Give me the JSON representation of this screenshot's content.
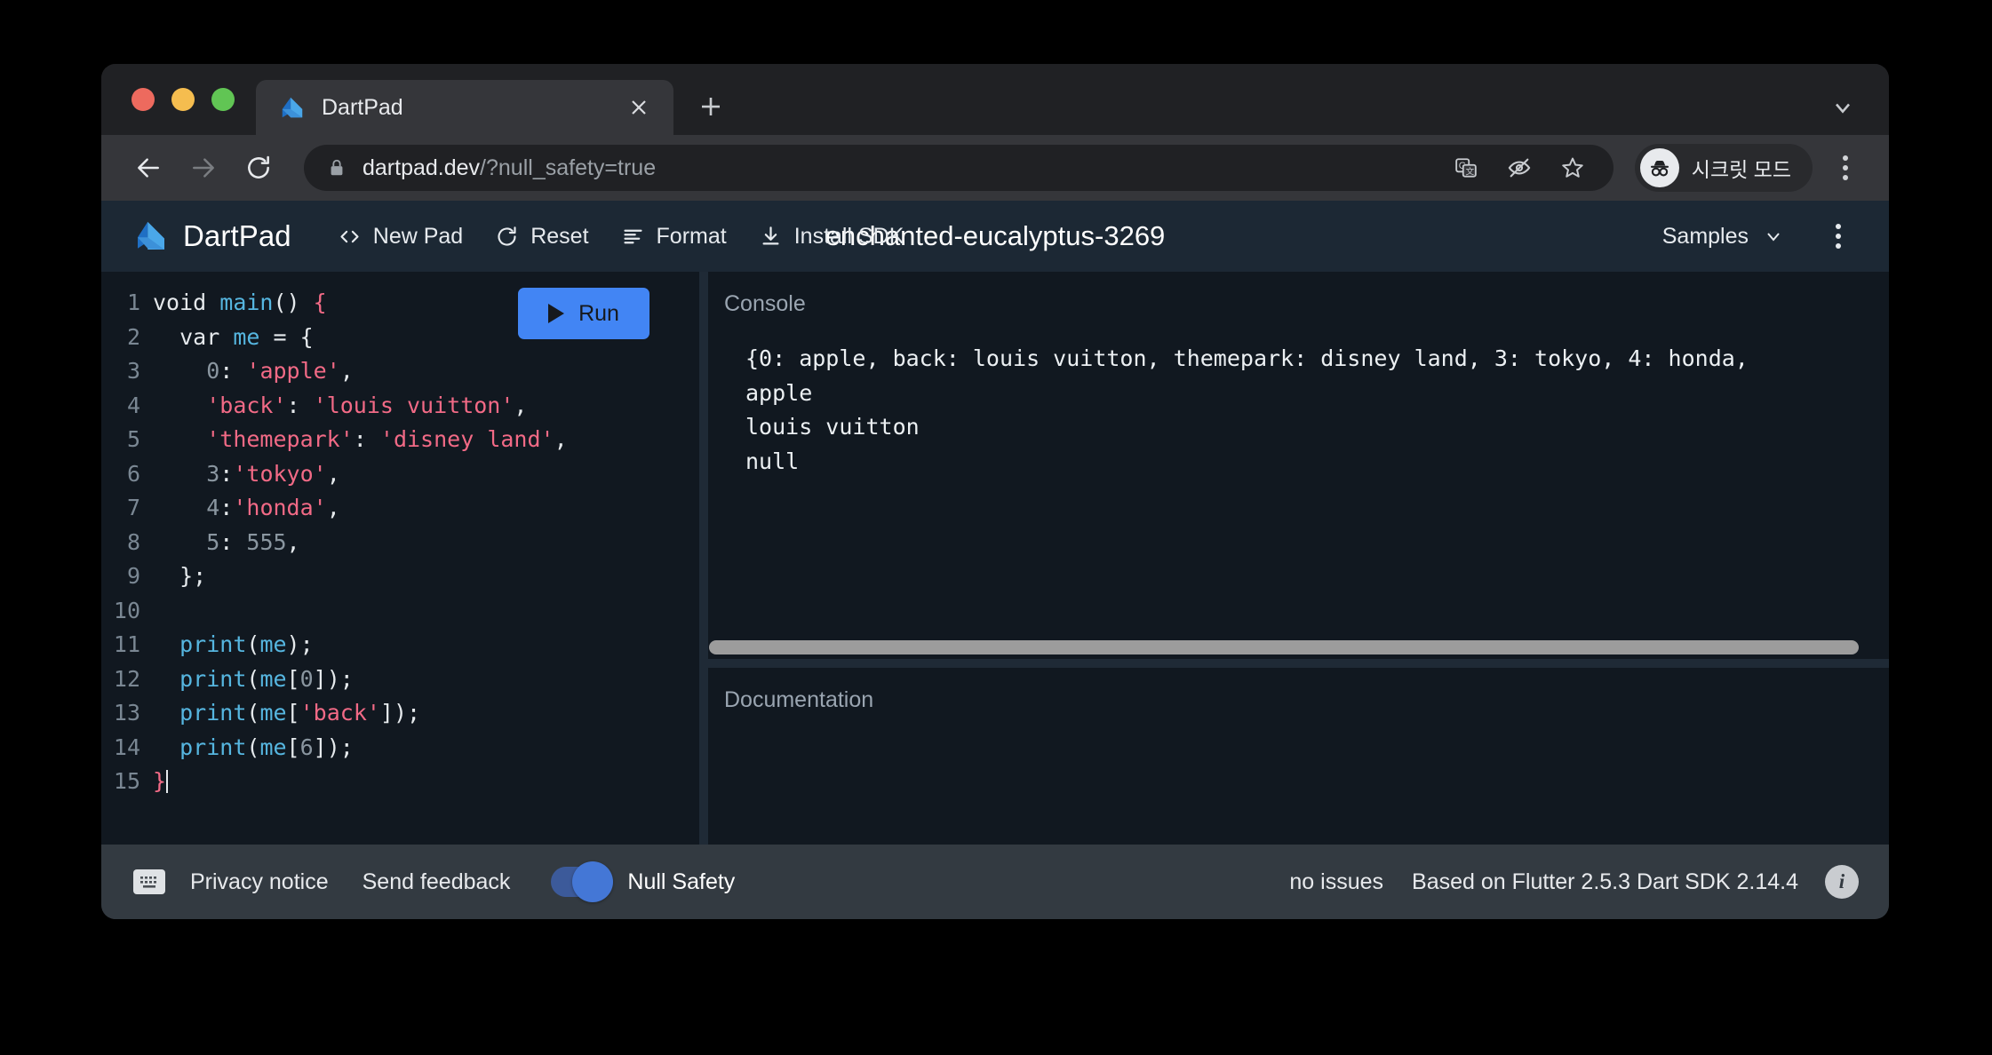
{
  "browser": {
    "window_controls": [
      "close",
      "minimize",
      "maximize"
    ],
    "tab": {
      "title": "DartPad",
      "favicon_name": "dart-logo-icon",
      "close_label": "✕"
    },
    "new_tab_label": "+",
    "tabstrip_chevron": "chevron-down-icon",
    "nav": {
      "back": "←",
      "forward": "→",
      "reload": "⟳"
    },
    "omnibox": {
      "host": "dartpad.dev",
      "path": "/?null_safety=true",
      "lock_icon": "lock-icon"
    },
    "omnibox_actions": [
      "translate-icon",
      "eye-off-icon",
      "star-icon"
    ],
    "incognito": {
      "label": "시크릿 모드",
      "icon": "incognito-icon"
    },
    "menu_icon": "kebab-menu-icon"
  },
  "dartpad": {
    "brand": "DartPad",
    "actions": [
      {
        "label": "New Pad",
        "icon": "code-brackets-icon"
      },
      {
        "label": "Reset",
        "icon": "refresh-icon"
      },
      {
        "label": "Format",
        "icon": "format-lines-icon"
      },
      {
        "label": "Install SDK",
        "icon": "download-icon"
      }
    ],
    "doc_title": "enchanted-eucalyptus-3269",
    "samples_label": "Samples",
    "samples_chevron": "chevron-down-icon",
    "overflow_icon": "kebab-menu-icon",
    "run_button": "Run",
    "editor": {
      "lines": [
        {
          "n": "1",
          "html": "<span class=\"k-kw\">void </span><span class=\"k-fn\">main</span><span class=\"k-punct\">() </span><span class=\"k-brace\">{</span>"
        },
        {
          "n": "2",
          "html": "  <span class=\"k-kw\">var </span><span class=\"k-fn\">me</span><span class=\"k-punct\"> = {</span>"
        },
        {
          "n": "3",
          "html": "    <span class=\"k-num\">0</span><span class=\"k-punct\">: </span><span class=\"k-str\">'apple'</span><span class=\"k-punct\">,</span>"
        },
        {
          "n": "4",
          "html": "    <span class=\"k-str\">'back'</span><span class=\"k-punct\">: </span><span class=\"k-str\">'louis vuitton'</span><span class=\"k-punct\">,</span>"
        },
        {
          "n": "5",
          "html": "    <span class=\"k-str\">'themepark'</span><span class=\"k-punct\">: </span><span class=\"k-str\">'disney land'</span><span class=\"k-punct\">,</span>"
        },
        {
          "n": "6",
          "html": "    <span class=\"k-num\">3</span><span class=\"k-punct\">:</span><span class=\"k-str\">'tokyo'</span><span class=\"k-punct\">,</span>"
        },
        {
          "n": "7",
          "html": "    <span class=\"k-num\">4</span><span class=\"k-punct\">:</span><span class=\"k-str\">'honda'</span><span class=\"k-punct\">,</span>"
        },
        {
          "n": "8",
          "html": "    <span class=\"k-num\">5</span><span class=\"k-punct\">: </span><span class=\"k-num\">555</span><span class=\"k-punct\">,</span>"
        },
        {
          "n": "9",
          "html": "  <span class=\"k-punct\">};</span>"
        },
        {
          "n": "10",
          "html": ""
        },
        {
          "n": "11",
          "html": "  <span class=\"k-fn\">print</span><span class=\"k-punct\">(</span><span class=\"k-fn\">me</span><span class=\"k-punct\">);</span>"
        },
        {
          "n": "12",
          "html": "  <span class=\"k-fn\">print</span><span class=\"k-punct\">(</span><span class=\"k-fn\">me</span><span class=\"k-punct\">[</span><span class=\"k-num\">0</span><span class=\"k-punct\">]);</span>"
        },
        {
          "n": "13",
          "html": "  <span class=\"k-fn\">print</span><span class=\"k-punct\">(</span><span class=\"k-fn\">me</span><span class=\"k-punct\">[</span><span class=\"k-str\">'back'</span><span class=\"k-punct\">]);</span>"
        },
        {
          "n": "14",
          "html": "  <span class=\"k-fn\">print</span><span class=\"k-punct\">(</span><span class=\"k-fn\">me</span><span class=\"k-punct\">[</span><span class=\"k-num\">6</span><span class=\"k-punct\">]);</span>"
        },
        {
          "n": "15",
          "html": "<span class=\"k-brace\">}</span><span class=\"caret\"></span>"
        }
      ]
    },
    "console": {
      "label": "Console",
      "output": "{0: apple, back: louis vuitton, themepark: disney land, 3: tokyo, 4: honda,\napple\nlouis vuitton\nnull"
    },
    "documentation": {
      "label": "Documentation"
    },
    "footer": {
      "keyboard_icon": "keyboard-icon",
      "privacy_notice": "Privacy notice",
      "send_feedback": "Send feedback",
      "null_safety_label": "Null Safety",
      "null_safety_on": true,
      "issues": "no issues",
      "sdk_info": "Based on Flutter 2.5.3 Dart SDK 2.14.4",
      "info_icon": "info-icon"
    }
  },
  "colors": {
    "accent": "#4285f4",
    "header_bg": "#1c2834",
    "editor_bg": "#111820",
    "footer_bg": "#333a41",
    "string": "#f26a86",
    "identifier": "#56b6e0"
  }
}
